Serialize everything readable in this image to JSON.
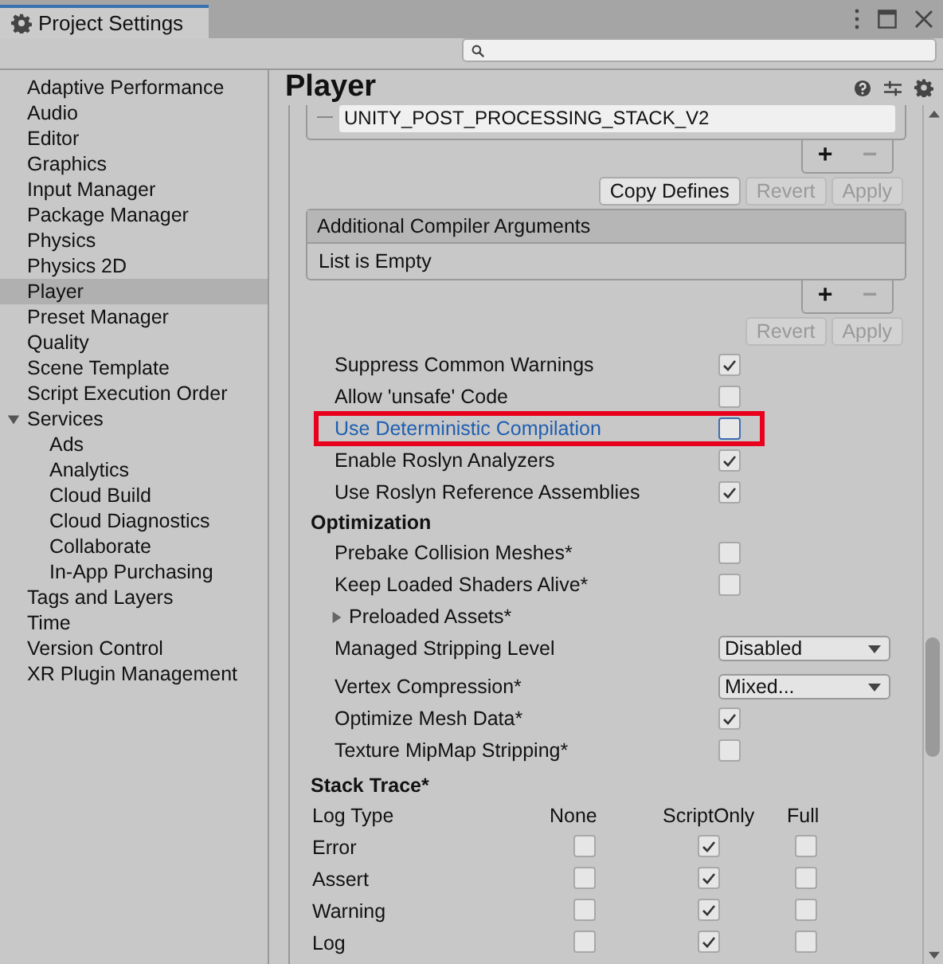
{
  "window": {
    "title": "Project Settings"
  },
  "sidebar": {
    "items": [
      {
        "label": "Adaptive Performance",
        "selected": false
      },
      {
        "label": "Audio",
        "selected": false
      },
      {
        "label": "Editor",
        "selected": false
      },
      {
        "label": "Graphics",
        "selected": false
      },
      {
        "label": "Input Manager",
        "selected": false
      },
      {
        "label": "Package Manager",
        "selected": false
      },
      {
        "label": "Physics",
        "selected": false
      },
      {
        "label": "Physics 2D",
        "selected": false
      },
      {
        "label": "Player",
        "selected": true
      },
      {
        "label": "Preset Manager",
        "selected": false
      },
      {
        "label": "Quality",
        "selected": false
      },
      {
        "label": "Scene Template",
        "selected": false
      },
      {
        "label": "Script Execution Order",
        "selected": false
      },
      {
        "label": "Services",
        "selected": false,
        "expanded": true,
        "children": [
          {
            "label": "Ads",
            "selected": false
          },
          {
            "label": "Analytics",
            "selected": false
          },
          {
            "label": "Cloud Build",
            "selected": false
          },
          {
            "label": "Cloud Diagnostics",
            "selected": false
          },
          {
            "label": "Collaborate",
            "selected": false
          },
          {
            "label": "In-App Purchasing",
            "selected": false
          }
        ]
      },
      {
        "label": "Tags and Layers",
        "selected": false
      },
      {
        "label": "Time",
        "selected": false
      },
      {
        "label": "Version Control",
        "selected": false
      },
      {
        "label": "XR Plugin Management",
        "selected": false
      }
    ]
  },
  "panel": {
    "title": "Player",
    "defines": {
      "value": "UNITY_POST_PROCESSING_STACK_V2",
      "add": "+",
      "remove": "−",
      "buttons": [
        {
          "label": "Copy Defines",
          "disabled": false
        },
        {
          "label": "Revert",
          "disabled": true
        },
        {
          "label": "Apply",
          "disabled": true
        }
      ]
    },
    "compiler_arguments": {
      "header": "Additional Compiler Arguments",
      "empty_text": "List is Empty",
      "add": "+",
      "remove": "−",
      "buttons": [
        {
          "label": "Revert",
          "disabled": true
        },
        {
          "label": "Apply",
          "disabled": true
        }
      ]
    },
    "settings": [
      {
        "kind": "checkbox",
        "label": "Suppress Common Warnings",
        "checked": true,
        "highlighted": false
      },
      {
        "kind": "checkbox",
        "label": "Allow 'unsafe' Code",
        "checked": false,
        "highlighted": false
      },
      {
        "kind": "checkbox",
        "label": "Use Deterministic Compilation",
        "checked": false,
        "highlighted": true
      },
      {
        "kind": "checkbox",
        "label": "Enable Roslyn Analyzers",
        "checked": true,
        "highlighted": false
      },
      {
        "kind": "checkbox",
        "label": "Use Roslyn Reference Assemblies",
        "checked": true,
        "highlighted": false
      },
      {
        "kind": "heading",
        "label": "Optimization"
      },
      {
        "kind": "checkbox",
        "label": "Prebake Collision Meshes*",
        "checked": false,
        "highlighted": false
      },
      {
        "kind": "checkbox",
        "label": "Keep Loaded Shaders Alive*",
        "checked": false,
        "highlighted": false
      },
      {
        "kind": "foldout",
        "label": "Preloaded Assets*",
        "expanded": false
      },
      {
        "kind": "dropdown",
        "label": "Managed Stripping Level",
        "value": "Disabled"
      },
      {
        "kind": "spacer"
      },
      {
        "kind": "dropdown",
        "label": "Vertex Compression*",
        "value": "Mixed..."
      },
      {
        "kind": "checkbox",
        "label": "Optimize Mesh Data*",
        "checked": true,
        "highlighted": false
      },
      {
        "kind": "checkbox",
        "label": "Texture MipMap Stripping*",
        "checked": false,
        "highlighted": false
      }
    ]
  },
  "stack_trace": {
    "title": "Stack Trace*",
    "columns": [
      "Log Type",
      "None",
      "ScriptOnly",
      "Full"
    ],
    "rows": [
      {
        "label": "Error",
        "none": false,
        "script_only": true,
        "full": false
      },
      {
        "label": "Assert",
        "none": false,
        "script_only": true,
        "full": false
      },
      {
        "label": "Warning",
        "none": false,
        "script_only": true,
        "full": false
      },
      {
        "label": "Log",
        "none": false,
        "script_only": true,
        "full": false
      }
    ]
  }
}
